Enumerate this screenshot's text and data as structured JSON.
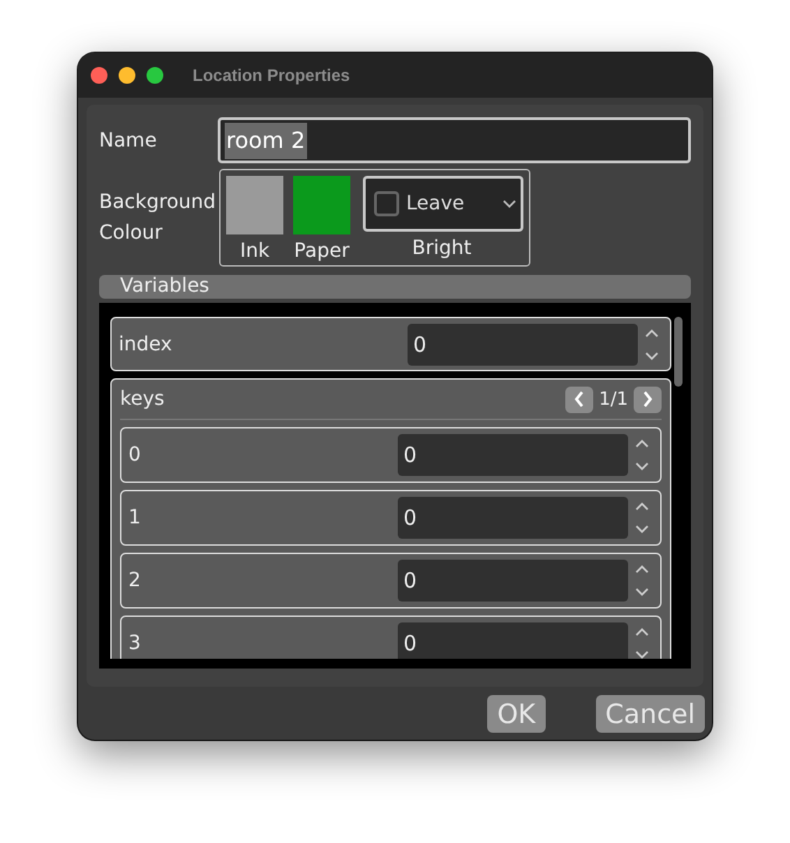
{
  "window": {
    "title": "Location Properties"
  },
  "name": {
    "label": "Name",
    "value": "room 2"
  },
  "background": {
    "label": "Background Colour",
    "swatches": [
      {
        "label": "Ink",
        "color": "#9a9a9a"
      },
      {
        "label": "Paper",
        "color": "#0b9a1c"
      }
    ],
    "bright": {
      "label": "Bright",
      "checked": false,
      "value": "Leave"
    }
  },
  "variables": {
    "title": "Variables",
    "index": {
      "label": "index",
      "value": "0"
    },
    "keys": {
      "label": "keys",
      "page": "1/1",
      "items": [
        {
          "label": "0",
          "value": "0"
        },
        {
          "label": "1",
          "value": "0"
        },
        {
          "label": "2",
          "value": "0"
        },
        {
          "label": "3",
          "value": "0"
        }
      ]
    }
  },
  "buttons": [
    "OK",
    "Cancel"
  ]
}
